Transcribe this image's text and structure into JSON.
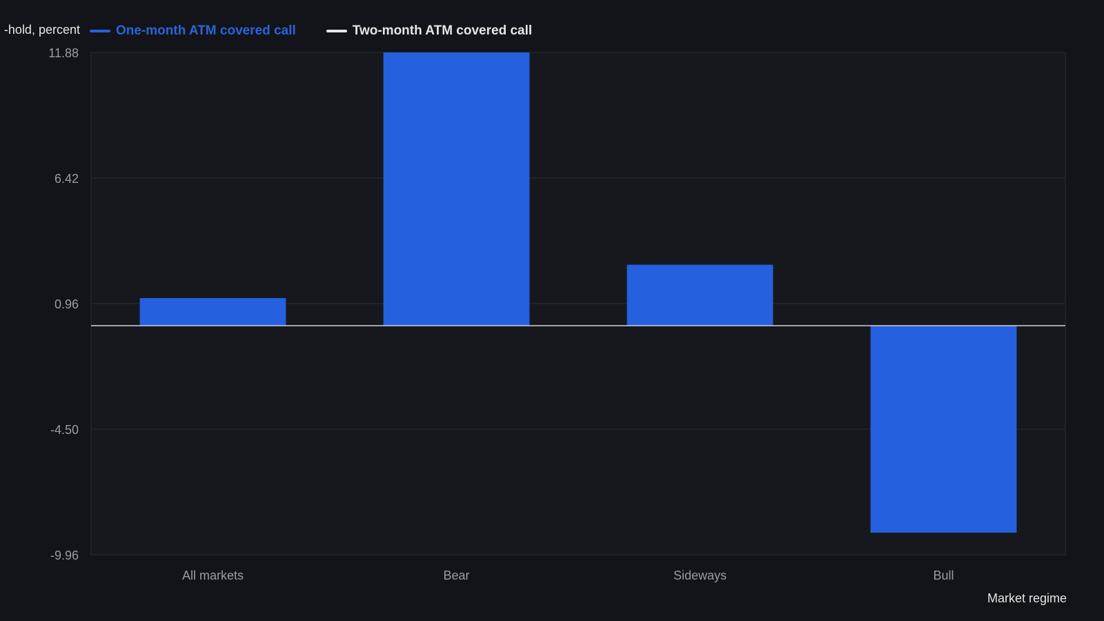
{
  "chart_data": {
    "type": "bar",
    "title": "",
    "xlabel": "Market regime",
    "ylabel": "-hold, percent",
    "categories": [
      "All markets",
      "Bear",
      "Sideways",
      "Bull"
    ],
    "series": [
      {
        "name": "One-month ATM covered call",
        "values": [
          1.2,
          11.88,
          2.65,
          -9.0
        ],
        "color": "#2560df"
      }
    ],
    "legend": [
      {
        "label": "One-month ATM covered call",
        "color": "#2560df",
        "text_color": "#2b63dc"
      },
      {
        "label": "Two-month ATM covered call",
        "color": "#e6e6e6",
        "text_color": "#e6e6e6"
      }
    ],
    "y_ticks": [
      "11.88",
      "6.42",
      "0.96",
      "-4.50",
      "-9.96"
    ],
    "ylim": [
      -9.96,
      11.88
    ],
    "baseline": 0,
    "grid": true,
    "legend_position": "top-left",
    "colors": {
      "background": "#131419",
      "plot_background": "#16181d",
      "grid": "#2a2d33",
      "tick_text": "#9a9ca3",
      "axis_text": "#e6e6e6",
      "zero_line": "#cfd3da"
    }
  }
}
